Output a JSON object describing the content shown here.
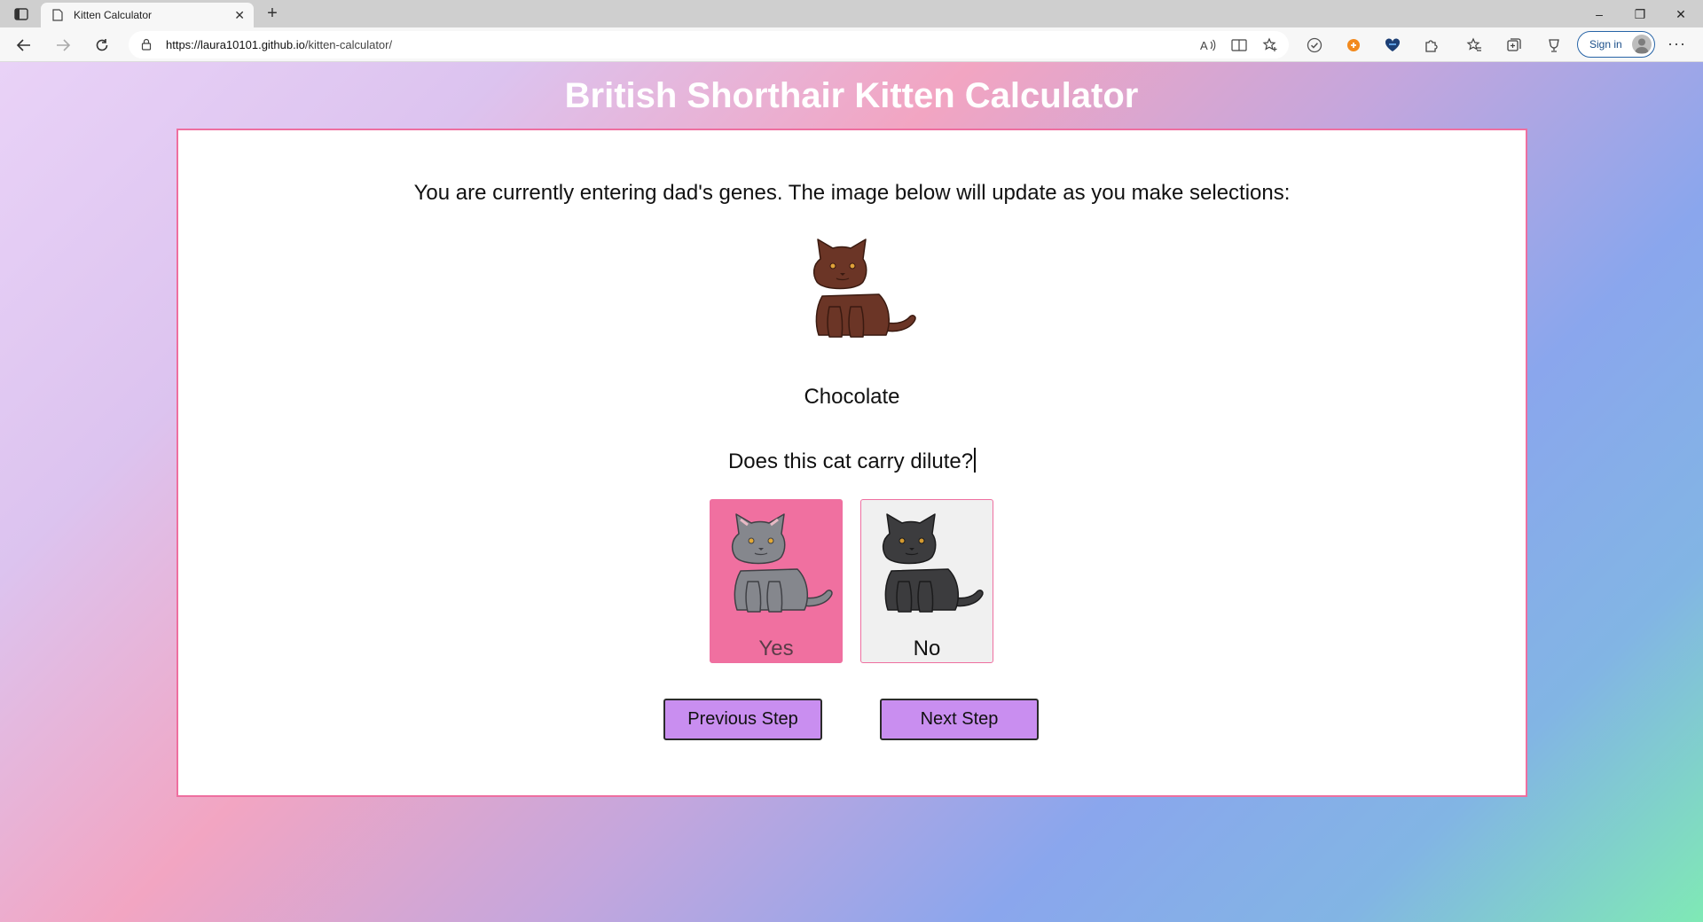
{
  "browser": {
    "tab_title": "Kitten Calculator",
    "tab_close": "✕",
    "new_tab": "+",
    "url_host": "https://laura10101.github.io",
    "url_path": "/kitten-calculator/",
    "sign_in": "Sign in",
    "more_menu": "···",
    "window_minimize": "–",
    "window_restore": "❐",
    "window_close": "✕"
  },
  "page": {
    "title": "British Shorthair Kitten Calculator",
    "instruction": "You are currently entering dad's genes. The image below will update as you make selections:",
    "color_name": "Chocolate",
    "question": "Does this cat carry dilute?",
    "options": [
      {
        "label": "Yes",
        "selected": true,
        "cat_color": "#85878d"
      },
      {
        "label": "No",
        "selected": false,
        "cat_color": "#3c3c3e"
      }
    ],
    "previous_button": "Previous Step",
    "next_button": "Next Step",
    "main_cat_color": "#6b3526"
  },
  "colors": {
    "accent_pink": "#f070a0",
    "border_pink": "#ee6fa0",
    "button_purple": "#c98ef0"
  }
}
